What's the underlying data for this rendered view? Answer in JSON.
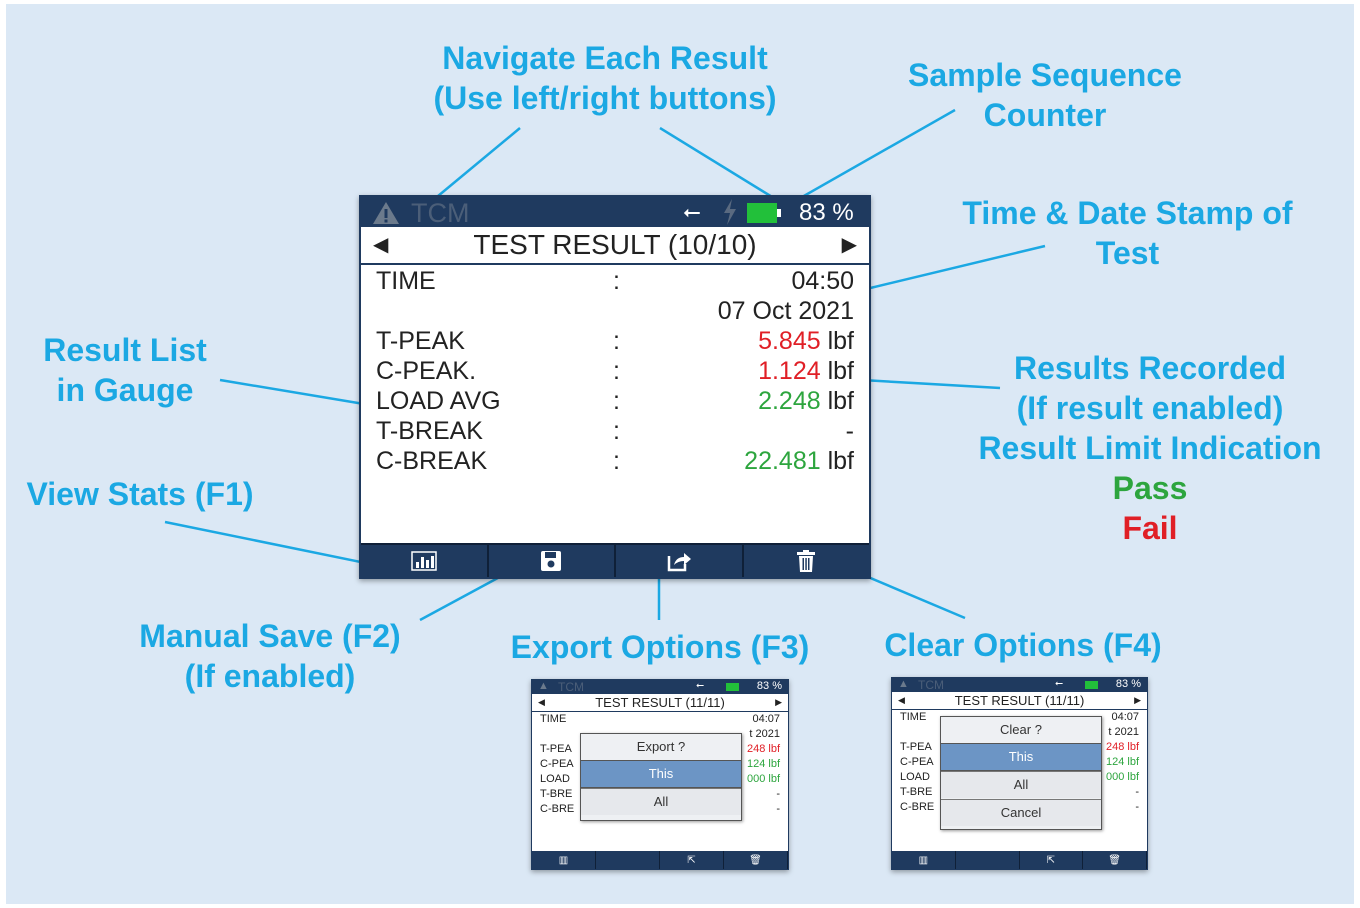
{
  "callouts": {
    "navigate": [
      "Navigate Each Result",
      "(Use left/right buttons)"
    ],
    "sequence": [
      "Sample Sequence",
      "Counter"
    ],
    "timestamp": [
      "Time & Date Stamp of",
      "Test"
    ],
    "result_list": [
      "Result List",
      "in Gauge"
    ],
    "results_recorded": [
      "Results Recorded",
      "(If result enabled)",
      "Result Limit Indication"
    ],
    "pass": "Pass",
    "fail": "Fail",
    "view_stats": "View Stats (F1)",
    "manual_save": [
      "Manual Save (F2)",
      "(If enabled)"
    ],
    "export": "Export Options (F3)",
    "clear": "Clear Options (F4)"
  },
  "main_screen": {
    "status": {
      "brand": "TCM",
      "battery": "83 %"
    },
    "title": "TEST RESULT (10/10)",
    "nav_left": "◀",
    "nav_right": "▶",
    "colon": ":",
    "time_label": "TIME",
    "time": "04:50",
    "date": "07 Oct 2021",
    "rows": [
      {
        "label": "T-PEAK",
        "value": "5.845",
        "unit": "lbf",
        "status": "fail"
      },
      {
        "label": "C-PEAK.",
        "value": "1.124",
        "unit": "lbf",
        "status": "fail"
      },
      {
        "label": "LOAD AVG",
        "value": "2.248",
        "unit": "lbf",
        "status": "pass"
      },
      {
        "label": "T-BREAK",
        "value": "-",
        "unit": "",
        "status": "none"
      },
      {
        "label": "C-BREAK",
        "value": "22.481",
        "unit": "lbf",
        "status": "pass"
      }
    ],
    "fkeys": [
      "stats-icon",
      "save-icon",
      "export-icon",
      "trash-icon"
    ]
  },
  "export_screen": {
    "status": {
      "brand": "TCM",
      "battery": "83 %"
    },
    "title": "TEST RESULT (11/11)",
    "time_label": "TIME",
    "time": "04:07",
    "date_partial": "t 2021",
    "labels": [
      "T-PEA",
      "C-PEA",
      "LOAD",
      "T-BRE",
      "C-BRE"
    ],
    "values": [
      "248 lbf",
      "124 lbf",
      "000 lbf",
      "-",
      "-"
    ],
    "dialog": {
      "title": "Export ?",
      "options": [
        "This",
        "All"
      ]
    }
  },
  "clear_screen": {
    "status": {
      "brand": "TCM",
      "battery": "83 %"
    },
    "title": "TEST RESULT (11/11)",
    "time_label": "TIME",
    "time": "04:07",
    "date_partial": "t 2021",
    "labels": [
      "T-PEA",
      "C-PEA",
      "LOAD",
      "T-BRE",
      "C-BRE"
    ],
    "values": [
      "248 lbf",
      "124 lbf",
      "000 lbf",
      "-",
      "-"
    ],
    "dialog": {
      "title": "Clear ?",
      "options": [
        "This",
        "All",
        "Cancel"
      ]
    }
  },
  "colors": {
    "callout": "#1ba8e3",
    "pass": "#2da53e",
    "fail": "#e01f26",
    "device_frame": "#1f3a5f",
    "battery": "#22c03a"
  }
}
